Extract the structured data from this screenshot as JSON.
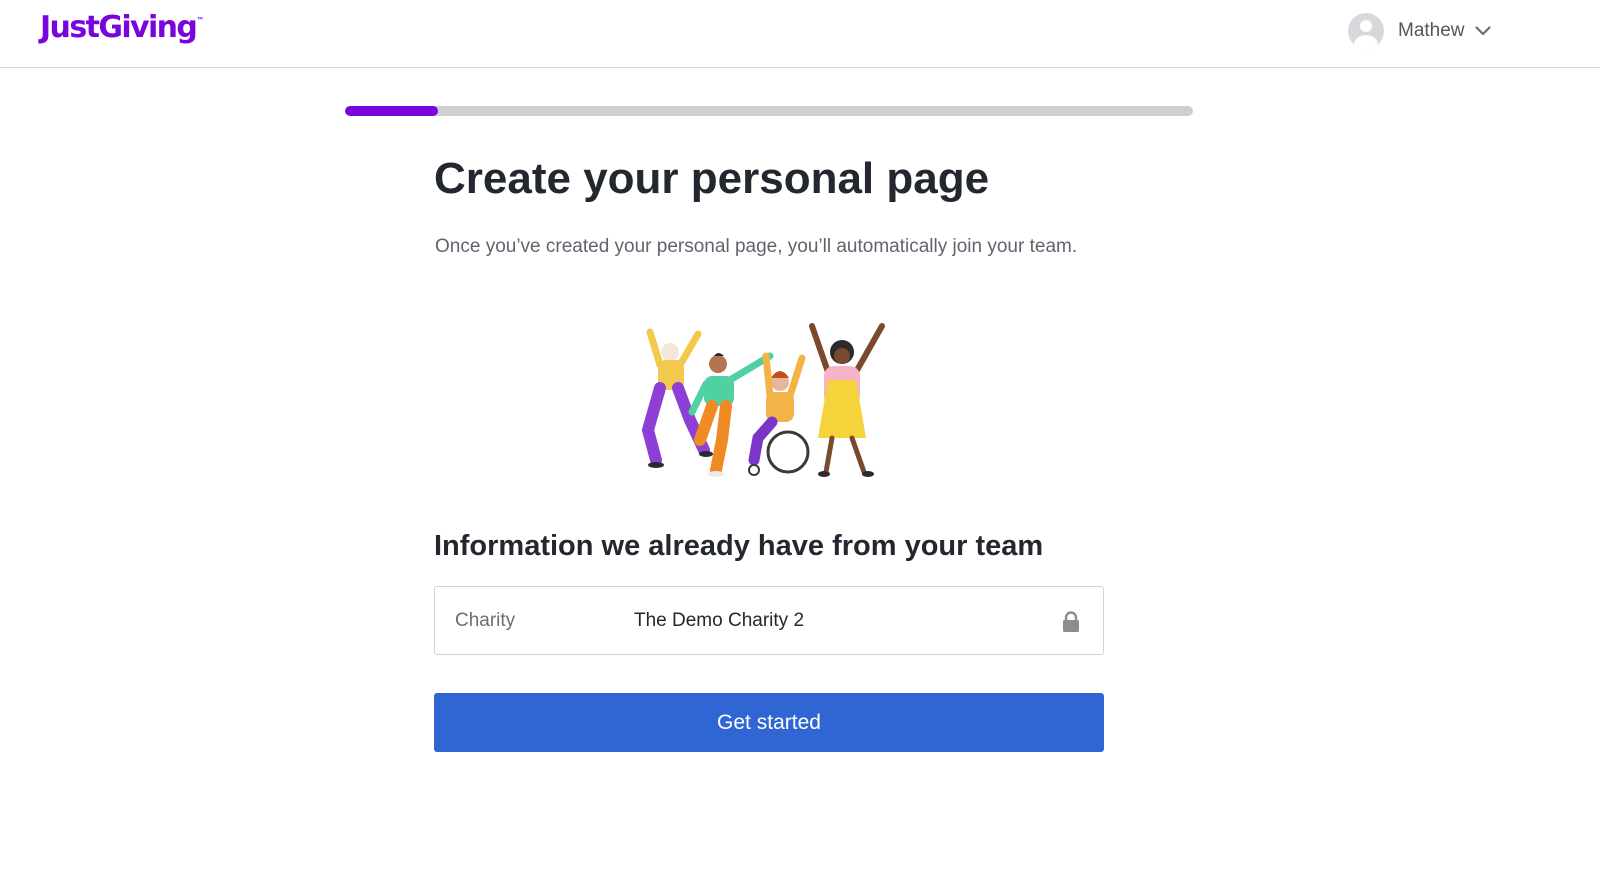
{
  "header": {
    "logo_text": "JustGiving",
    "logo_tm": "™",
    "user_name": "Mathew"
  },
  "progress": {
    "fraction": 0.11
  },
  "main": {
    "title": "Create your personal page",
    "subtitle": "Once you’ve created your personal page, you’ll automatically join your team.",
    "section_heading": "Information we already have from your team",
    "info": {
      "label": "Charity",
      "value": "The Demo Charity 2"
    },
    "cta_label": "Get started"
  },
  "colors": {
    "brand_purple": "#7a04dd",
    "button_blue": "#3066d4"
  },
  "icons": [
    "user-avatar-icon",
    "chevron-down-icon",
    "lock-icon"
  ]
}
